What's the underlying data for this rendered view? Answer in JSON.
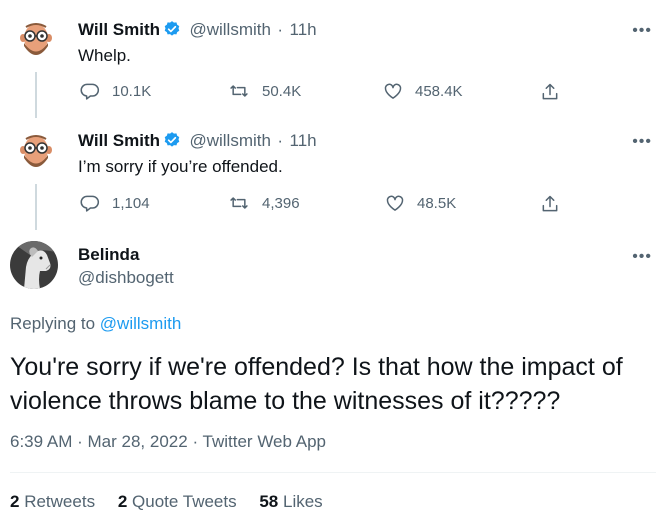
{
  "tweets": [
    {
      "name": "Will Smith",
      "handle": "@willsmith",
      "time": "11h",
      "text": "Whelp.",
      "replies": "10.1K",
      "retweets": "50.4K",
      "likes": "458.4K"
    },
    {
      "name": "Will Smith",
      "handle": "@willsmith",
      "time": "11h",
      "text": "I’m sorry if you’re offended.",
      "replies": "1,104",
      "retweets": "4,396",
      "likes": "48.5K"
    }
  ],
  "main": {
    "name": "Belinda",
    "handle": "@dishbogett",
    "replying_prefix": "Replying to",
    "replying_to": "@willsmith",
    "text": "You're sorry if we're offended?  Is that how the impact of violence throws blame to the witnesses of it?????",
    "time": "6:39 AM",
    "date": "Mar 28, 2022",
    "source": "Twitter Web App",
    "retweets_count": "2",
    "retweets_label": "Retweets",
    "quotes_count": "2",
    "quotes_label": "Quote Tweets",
    "likes_count": "58",
    "likes_label": "Likes"
  },
  "more_glyph": "•••",
  "meta_separator": "·",
  "colors": {
    "accent": "#1d9bf0",
    "muted": "#536471",
    "text": "#0f1419",
    "border": "#cfd9de"
  },
  "icons": [
    "reply-icon",
    "retweet-icon",
    "like-icon",
    "share-icon",
    "verified-badge-icon",
    "more-icon"
  ]
}
